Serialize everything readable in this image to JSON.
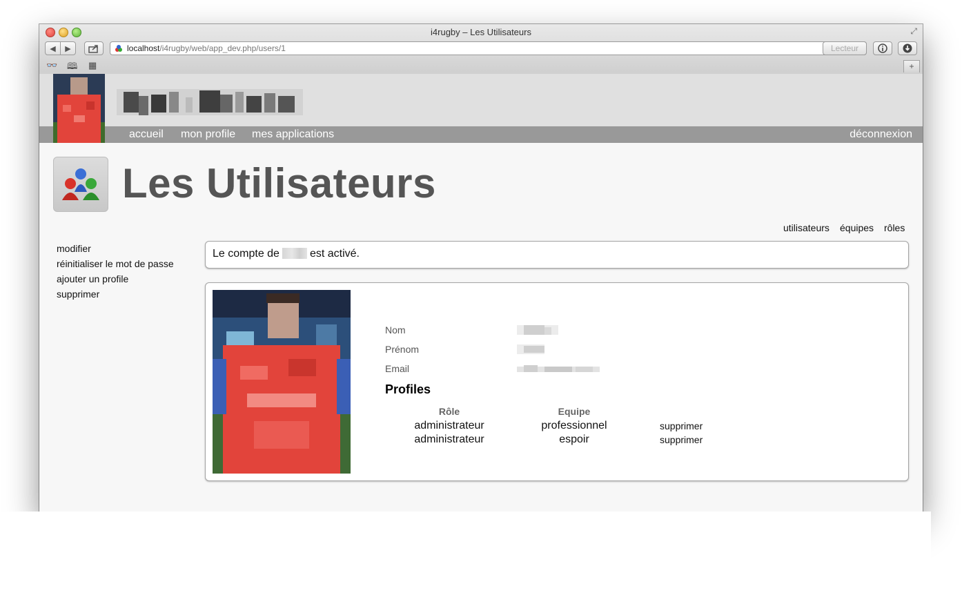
{
  "browser": {
    "window_title": "i4rugby – Les Utilisateurs",
    "url_host": "localhost",
    "url_path": "/i4rugby/web/app_dev.php/users/1",
    "reader_label": "Lecteur",
    "new_tab_label": "+"
  },
  "site": {
    "nav": {
      "home": "accueil",
      "profile": "mon profile",
      "apps": "mes applications",
      "logout": "déconnexion"
    }
  },
  "page": {
    "title": "Les Utilisateurs"
  },
  "subnav": {
    "users": "utilisateurs",
    "teams": "équipes",
    "roles": "rôles"
  },
  "sidebar": {
    "items": [
      {
        "label": "modifier"
      },
      {
        "label": "réinitialiser le mot de passe"
      },
      {
        "label": "ajouter un profile"
      },
      {
        "label": "supprimer"
      }
    ]
  },
  "flash": {
    "prefix": "Le compte de",
    "suffix": "est activé."
  },
  "user": {
    "labels": {
      "last_name": "Nom",
      "first_name": "Prénom",
      "email": "Email"
    }
  },
  "profiles": {
    "title": "Profiles",
    "headers": {
      "role": "Rôle",
      "team": "Equipe"
    },
    "rows": [
      {
        "role": "administrateur",
        "team": "professionnel",
        "action": "supprimer"
      },
      {
        "role": "administrateur",
        "team": "espoir",
        "action": "supprimer"
      }
    ]
  },
  "colors": {
    "header_bg": "#e0e0e0",
    "nav_bg": "#999999",
    "title_color": "#555555",
    "page_bg": "#f7f7f7"
  }
}
